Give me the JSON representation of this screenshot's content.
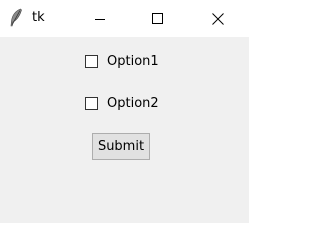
{
  "window": {
    "title": "tk",
    "app_icon": "feather-icon",
    "controls": {
      "minimize_icon": "minimize-icon",
      "maximize_icon": "maximize-icon",
      "close_icon": "close-icon"
    }
  },
  "form": {
    "checkboxes": [
      {
        "label": "Option1",
        "checked": false
      },
      {
        "label": "Option2",
        "checked": false
      }
    ],
    "submit_label": "Submit"
  },
  "colors": {
    "titlebar_bg": "#ffffff",
    "client_bg": "#f0f0f0",
    "button_bg": "#e1e1e1",
    "button_border": "#adadad"
  }
}
